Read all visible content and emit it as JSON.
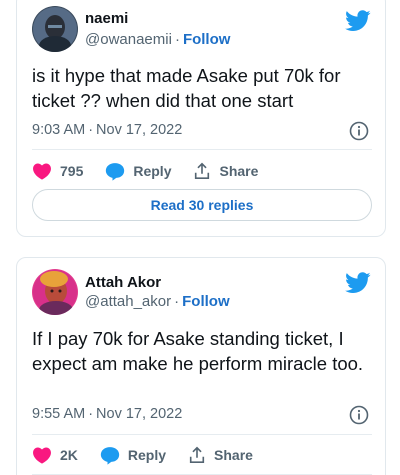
{
  "tweets": [
    {
      "name": "naemi",
      "handle": "@owanaemii",
      "separator": "·",
      "follow_label": "Follow",
      "text": "is it hype that made Asake put 70k for ticket ?? when did that one start",
      "time": "9:03 AM",
      "date": "Nov 17, 2022",
      "likes": "795",
      "reply_label": "Reply",
      "share_label": "Share",
      "read_replies_label": "Read 30 replies"
    },
    {
      "name": "Attah Akor",
      "handle": "@attah_akor",
      "separator": "·",
      "follow_label": "Follow",
      "text": "If I pay 70k for Asake standing ticket, I expect am make he perform miracle too.",
      "time": "9:55 AM",
      "date": "Nov 17, 2022",
      "likes": "2K",
      "reply_label": "Reply",
      "share_label": "Share"
    }
  ],
  "colors": {
    "twitter_blue": "#1d9bf0",
    "like_red": "#f91880",
    "link_blue": "#1d6fc7",
    "muted_text": "#536471"
  },
  "icons": [
    "twitter-bird-icon",
    "info-icon",
    "heart-icon",
    "reply-bubble-icon",
    "share-icon"
  ]
}
